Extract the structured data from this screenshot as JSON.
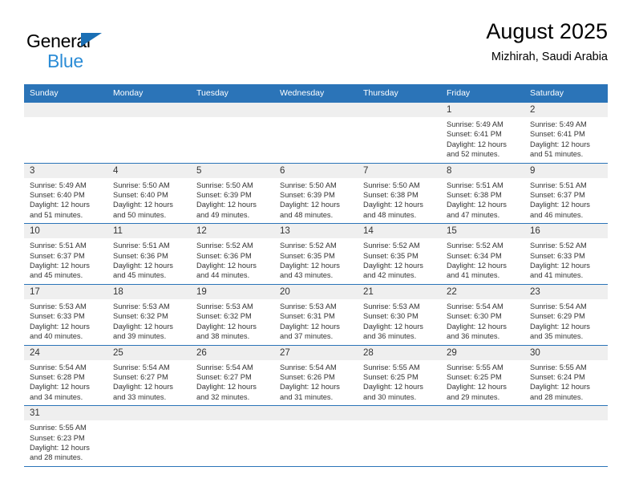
{
  "brand": {
    "name_part1": "General",
    "name_part2": "Blue",
    "flag_icon": "triangle-flag-icon",
    "color_dark_blue": "#1a6fb5",
    "color_light_blue": "#2b8cd6"
  },
  "header": {
    "title": "August 2025",
    "subtitle": "Mizhirah, Saudi Arabia"
  },
  "theme": {
    "header_blue": "#2b74b8",
    "daynum_strip_gray": "#efefef",
    "text_color": "#333333"
  },
  "calendar": {
    "weekday_headers": [
      "Sunday",
      "Monday",
      "Tuesday",
      "Wednesday",
      "Thursday",
      "Friday",
      "Saturday"
    ],
    "weeks": [
      [
        {
          "day": "",
          "sunrise": "",
          "sunset": "",
          "daylight_line1": "",
          "daylight_line2": ""
        },
        {
          "day": "",
          "sunrise": "",
          "sunset": "",
          "daylight_line1": "",
          "daylight_line2": ""
        },
        {
          "day": "",
          "sunrise": "",
          "sunset": "",
          "daylight_line1": "",
          "daylight_line2": ""
        },
        {
          "day": "",
          "sunrise": "",
          "sunset": "",
          "daylight_line1": "",
          "daylight_line2": ""
        },
        {
          "day": "",
          "sunrise": "",
          "sunset": "",
          "daylight_line1": "",
          "daylight_line2": ""
        },
        {
          "day": "1",
          "sunrise": "Sunrise: 5:49 AM",
          "sunset": "Sunset: 6:41 PM",
          "daylight_line1": "Daylight: 12 hours",
          "daylight_line2": "and 52 minutes."
        },
        {
          "day": "2",
          "sunrise": "Sunrise: 5:49 AM",
          "sunset": "Sunset: 6:41 PM",
          "daylight_line1": "Daylight: 12 hours",
          "daylight_line2": "and 51 minutes."
        }
      ],
      [
        {
          "day": "3",
          "sunrise": "Sunrise: 5:49 AM",
          "sunset": "Sunset: 6:40 PM",
          "daylight_line1": "Daylight: 12 hours",
          "daylight_line2": "and 51 minutes."
        },
        {
          "day": "4",
          "sunrise": "Sunrise: 5:50 AM",
          "sunset": "Sunset: 6:40 PM",
          "daylight_line1": "Daylight: 12 hours",
          "daylight_line2": "and 50 minutes."
        },
        {
          "day": "5",
          "sunrise": "Sunrise: 5:50 AM",
          "sunset": "Sunset: 6:39 PM",
          "daylight_line1": "Daylight: 12 hours",
          "daylight_line2": "and 49 minutes."
        },
        {
          "day": "6",
          "sunrise": "Sunrise: 5:50 AM",
          "sunset": "Sunset: 6:39 PM",
          "daylight_line1": "Daylight: 12 hours",
          "daylight_line2": "and 48 minutes."
        },
        {
          "day": "7",
          "sunrise": "Sunrise: 5:50 AM",
          "sunset": "Sunset: 6:38 PM",
          "daylight_line1": "Daylight: 12 hours",
          "daylight_line2": "and 48 minutes."
        },
        {
          "day": "8",
          "sunrise": "Sunrise: 5:51 AM",
          "sunset": "Sunset: 6:38 PM",
          "daylight_line1": "Daylight: 12 hours",
          "daylight_line2": "and 47 minutes."
        },
        {
          "day": "9",
          "sunrise": "Sunrise: 5:51 AM",
          "sunset": "Sunset: 6:37 PM",
          "daylight_line1": "Daylight: 12 hours",
          "daylight_line2": "and 46 minutes."
        }
      ],
      [
        {
          "day": "10",
          "sunrise": "Sunrise: 5:51 AM",
          "sunset": "Sunset: 6:37 PM",
          "daylight_line1": "Daylight: 12 hours",
          "daylight_line2": "and 45 minutes."
        },
        {
          "day": "11",
          "sunrise": "Sunrise: 5:51 AM",
          "sunset": "Sunset: 6:36 PM",
          "daylight_line1": "Daylight: 12 hours",
          "daylight_line2": "and 45 minutes."
        },
        {
          "day": "12",
          "sunrise": "Sunrise: 5:52 AM",
          "sunset": "Sunset: 6:36 PM",
          "daylight_line1": "Daylight: 12 hours",
          "daylight_line2": "and 44 minutes."
        },
        {
          "day": "13",
          "sunrise": "Sunrise: 5:52 AM",
          "sunset": "Sunset: 6:35 PM",
          "daylight_line1": "Daylight: 12 hours",
          "daylight_line2": "and 43 minutes."
        },
        {
          "day": "14",
          "sunrise": "Sunrise: 5:52 AM",
          "sunset": "Sunset: 6:35 PM",
          "daylight_line1": "Daylight: 12 hours",
          "daylight_line2": "and 42 minutes."
        },
        {
          "day": "15",
          "sunrise": "Sunrise: 5:52 AM",
          "sunset": "Sunset: 6:34 PM",
          "daylight_line1": "Daylight: 12 hours",
          "daylight_line2": "and 41 minutes."
        },
        {
          "day": "16",
          "sunrise": "Sunrise: 5:52 AM",
          "sunset": "Sunset: 6:33 PM",
          "daylight_line1": "Daylight: 12 hours",
          "daylight_line2": "and 41 minutes."
        }
      ],
      [
        {
          "day": "17",
          "sunrise": "Sunrise: 5:53 AM",
          "sunset": "Sunset: 6:33 PM",
          "daylight_line1": "Daylight: 12 hours",
          "daylight_line2": "and 40 minutes."
        },
        {
          "day": "18",
          "sunrise": "Sunrise: 5:53 AM",
          "sunset": "Sunset: 6:32 PM",
          "daylight_line1": "Daylight: 12 hours",
          "daylight_line2": "and 39 minutes."
        },
        {
          "day": "19",
          "sunrise": "Sunrise: 5:53 AM",
          "sunset": "Sunset: 6:32 PM",
          "daylight_line1": "Daylight: 12 hours",
          "daylight_line2": "and 38 minutes."
        },
        {
          "day": "20",
          "sunrise": "Sunrise: 5:53 AM",
          "sunset": "Sunset: 6:31 PM",
          "daylight_line1": "Daylight: 12 hours",
          "daylight_line2": "and 37 minutes."
        },
        {
          "day": "21",
          "sunrise": "Sunrise: 5:53 AM",
          "sunset": "Sunset: 6:30 PM",
          "daylight_line1": "Daylight: 12 hours",
          "daylight_line2": "and 36 minutes."
        },
        {
          "day": "22",
          "sunrise": "Sunrise: 5:54 AM",
          "sunset": "Sunset: 6:30 PM",
          "daylight_line1": "Daylight: 12 hours",
          "daylight_line2": "and 36 minutes."
        },
        {
          "day": "23",
          "sunrise": "Sunrise: 5:54 AM",
          "sunset": "Sunset: 6:29 PM",
          "daylight_line1": "Daylight: 12 hours",
          "daylight_line2": "and 35 minutes."
        }
      ],
      [
        {
          "day": "24",
          "sunrise": "Sunrise: 5:54 AM",
          "sunset": "Sunset: 6:28 PM",
          "daylight_line1": "Daylight: 12 hours",
          "daylight_line2": "and 34 minutes."
        },
        {
          "day": "25",
          "sunrise": "Sunrise: 5:54 AM",
          "sunset": "Sunset: 6:27 PM",
          "daylight_line1": "Daylight: 12 hours",
          "daylight_line2": "and 33 minutes."
        },
        {
          "day": "26",
          "sunrise": "Sunrise: 5:54 AM",
          "sunset": "Sunset: 6:27 PM",
          "daylight_line1": "Daylight: 12 hours",
          "daylight_line2": "and 32 minutes."
        },
        {
          "day": "27",
          "sunrise": "Sunrise: 5:54 AM",
          "sunset": "Sunset: 6:26 PM",
          "daylight_line1": "Daylight: 12 hours",
          "daylight_line2": "and 31 minutes."
        },
        {
          "day": "28",
          "sunrise": "Sunrise: 5:55 AM",
          "sunset": "Sunset: 6:25 PM",
          "daylight_line1": "Daylight: 12 hours",
          "daylight_line2": "and 30 minutes."
        },
        {
          "day": "29",
          "sunrise": "Sunrise: 5:55 AM",
          "sunset": "Sunset: 6:25 PM",
          "daylight_line1": "Daylight: 12 hours",
          "daylight_line2": "and 29 minutes."
        },
        {
          "day": "30",
          "sunrise": "Sunrise: 5:55 AM",
          "sunset": "Sunset: 6:24 PM",
          "daylight_line1": "Daylight: 12 hours",
          "daylight_line2": "and 28 minutes."
        }
      ],
      [
        {
          "day": "31",
          "sunrise": "Sunrise: 5:55 AM",
          "sunset": "Sunset: 6:23 PM",
          "daylight_line1": "Daylight: 12 hours",
          "daylight_line2": "and 28 minutes."
        },
        {
          "day": "",
          "sunrise": "",
          "sunset": "",
          "daylight_line1": "",
          "daylight_line2": ""
        },
        {
          "day": "",
          "sunrise": "",
          "sunset": "",
          "daylight_line1": "",
          "daylight_line2": ""
        },
        {
          "day": "",
          "sunrise": "",
          "sunset": "",
          "daylight_line1": "",
          "daylight_line2": ""
        },
        {
          "day": "",
          "sunrise": "",
          "sunset": "",
          "daylight_line1": "",
          "daylight_line2": ""
        },
        {
          "day": "",
          "sunrise": "",
          "sunset": "",
          "daylight_line1": "",
          "daylight_line2": ""
        },
        {
          "day": "",
          "sunrise": "",
          "sunset": "",
          "daylight_line1": "",
          "daylight_line2": ""
        }
      ]
    ]
  }
}
